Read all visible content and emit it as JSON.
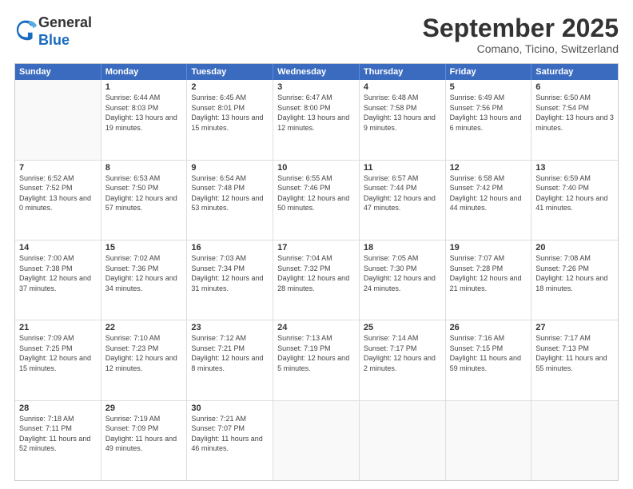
{
  "header": {
    "logo": {
      "general": "General",
      "blue": "Blue"
    },
    "title": "September 2025",
    "location": "Comano, Ticino, Switzerland"
  },
  "days_of_week": [
    "Sunday",
    "Monday",
    "Tuesday",
    "Wednesday",
    "Thursday",
    "Friday",
    "Saturday"
  ],
  "weeks": [
    [
      {
        "day": "",
        "empty": true
      },
      {
        "day": "1",
        "sunrise": "Sunrise: 6:44 AM",
        "sunset": "Sunset: 8:03 PM",
        "daylight": "Daylight: 13 hours and 19 minutes."
      },
      {
        "day": "2",
        "sunrise": "Sunrise: 6:45 AM",
        "sunset": "Sunset: 8:01 PM",
        "daylight": "Daylight: 13 hours and 15 minutes."
      },
      {
        "day": "3",
        "sunrise": "Sunrise: 6:47 AM",
        "sunset": "Sunset: 8:00 PM",
        "daylight": "Daylight: 13 hours and 12 minutes."
      },
      {
        "day": "4",
        "sunrise": "Sunrise: 6:48 AM",
        "sunset": "Sunset: 7:58 PM",
        "daylight": "Daylight: 13 hours and 9 minutes."
      },
      {
        "day": "5",
        "sunrise": "Sunrise: 6:49 AM",
        "sunset": "Sunset: 7:56 PM",
        "daylight": "Daylight: 13 hours and 6 minutes."
      },
      {
        "day": "6",
        "sunrise": "Sunrise: 6:50 AM",
        "sunset": "Sunset: 7:54 PM",
        "daylight": "Daylight: 13 hours and 3 minutes."
      }
    ],
    [
      {
        "day": "7",
        "sunrise": "Sunrise: 6:52 AM",
        "sunset": "Sunset: 7:52 PM",
        "daylight": "Daylight: 13 hours and 0 minutes."
      },
      {
        "day": "8",
        "sunrise": "Sunrise: 6:53 AM",
        "sunset": "Sunset: 7:50 PM",
        "daylight": "Daylight: 12 hours and 57 minutes."
      },
      {
        "day": "9",
        "sunrise": "Sunrise: 6:54 AM",
        "sunset": "Sunset: 7:48 PM",
        "daylight": "Daylight: 12 hours and 53 minutes."
      },
      {
        "day": "10",
        "sunrise": "Sunrise: 6:55 AM",
        "sunset": "Sunset: 7:46 PM",
        "daylight": "Daylight: 12 hours and 50 minutes."
      },
      {
        "day": "11",
        "sunrise": "Sunrise: 6:57 AM",
        "sunset": "Sunset: 7:44 PM",
        "daylight": "Daylight: 12 hours and 47 minutes."
      },
      {
        "day": "12",
        "sunrise": "Sunrise: 6:58 AM",
        "sunset": "Sunset: 7:42 PM",
        "daylight": "Daylight: 12 hours and 44 minutes."
      },
      {
        "day": "13",
        "sunrise": "Sunrise: 6:59 AM",
        "sunset": "Sunset: 7:40 PM",
        "daylight": "Daylight: 12 hours and 41 minutes."
      }
    ],
    [
      {
        "day": "14",
        "sunrise": "Sunrise: 7:00 AM",
        "sunset": "Sunset: 7:38 PM",
        "daylight": "Daylight: 12 hours and 37 minutes."
      },
      {
        "day": "15",
        "sunrise": "Sunrise: 7:02 AM",
        "sunset": "Sunset: 7:36 PM",
        "daylight": "Daylight: 12 hours and 34 minutes."
      },
      {
        "day": "16",
        "sunrise": "Sunrise: 7:03 AM",
        "sunset": "Sunset: 7:34 PM",
        "daylight": "Daylight: 12 hours and 31 minutes."
      },
      {
        "day": "17",
        "sunrise": "Sunrise: 7:04 AM",
        "sunset": "Sunset: 7:32 PM",
        "daylight": "Daylight: 12 hours and 28 minutes."
      },
      {
        "day": "18",
        "sunrise": "Sunrise: 7:05 AM",
        "sunset": "Sunset: 7:30 PM",
        "daylight": "Daylight: 12 hours and 24 minutes."
      },
      {
        "day": "19",
        "sunrise": "Sunrise: 7:07 AM",
        "sunset": "Sunset: 7:28 PM",
        "daylight": "Daylight: 12 hours and 21 minutes."
      },
      {
        "day": "20",
        "sunrise": "Sunrise: 7:08 AM",
        "sunset": "Sunset: 7:26 PM",
        "daylight": "Daylight: 12 hours and 18 minutes."
      }
    ],
    [
      {
        "day": "21",
        "sunrise": "Sunrise: 7:09 AM",
        "sunset": "Sunset: 7:25 PM",
        "daylight": "Daylight: 12 hours and 15 minutes."
      },
      {
        "day": "22",
        "sunrise": "Sunrise: 7:10 AM",
        "sunset": "Sunset: 7:23 PM",
        "daylight": "Daylight: 12 hours and 12 minutes."
      },
      {
        "day": "23",
        "sunrise": "Sunrise: 7:12 AM",
        "sunset": "Sunset: 7:21 PM",
        "daylight": "Daylight: 12 hours and 8 minutes."
      },
      {
        "day": "24",
        "sunrise": "Sunrise: 7:13 AM",
        "sunset": "Sunset: 7:19 PM",
        "daylight": "Daylight: 12 hours and 5 minutes."
      },
      {
        "day": "25",
        "sunrise": "Sunrise: 7:14 AM",
        "sunset": "Sunset: 7:17 PM",
        "daylight": "Daylight: 12 hours and 2 minutes."
      },
      {
        "day": "26",
        "sunrise": "Sunrise: 7:16 AM",
        "sunset": "Sunset: 7:15 PM",
        "daylight": "Daylight: 11 hours and 59 minutes."
      },
      {
        "day": "27",
        "sunrise": "Sunrise: 7:17 AM",
        "sunset": "Sunset: 7:13 PM",
        "daylight": "Daylight: 11 hours and 55 minutes."
      }
    ],
    [
      {
        "day": "28",
        "sunrise": "Sunrise: 7:18 AM",
        "sunset": "Sunset: 7:11 PM",
        "daylight": "Daylight: 11 hours and 52 minutes."
      },
      {
        "day": "29",
        "sunrise": "Sunrise: 7:19 AM",
        "sunset": "Sunset: 7:09 PM",
        "daylight": "Daylight: 11 hours and 49 minutes."
      },
      {
        "day": "30",
        "sunrise": "Sunrise: 7:21 AM",
        "sunset": "Sunset: 7:07 PM",
        "daylight": "Daylight: 11 hours and 46 minutes."
      },
      {
        "day": "",
        "empty": true
      },
      {
        "day": "",
        "empty": true
      },
      {
        "day": "",
        "empty": true
      },
      {
        "day": "",
        "empty": true
      }
    ]
  ]
}
